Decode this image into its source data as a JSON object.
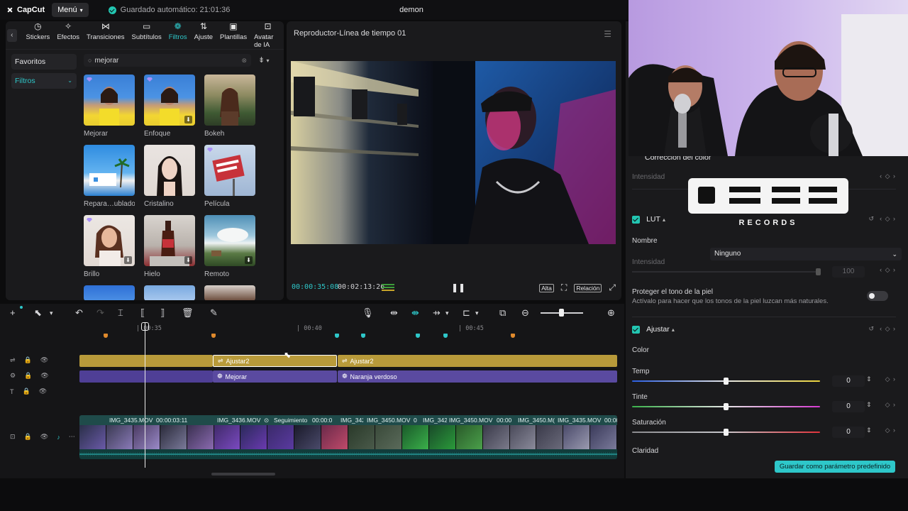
{
  "app": {
    "brand": "CapCut",
    "menu_label": "Menú",
    "autosave_text": "Guardado automático: 21:01:36",
    "project_name": "demon"
  },
  "media_tabs": [
    {
      "label": "Stickers",
      "icon": "clock-icon"
    },
    {
      "label": "Efectos",
      "icon": "star-icon"
    },
    {
      "label": "Transiciones",
      "icon": "bowtie-icon"
    },
    {
      "label": "Subtítulos",
      "icon": "caption-icon"
    },
    {
      "label": "Filtros",
      "icon": "filters-icon",
      "active": true
    },
    {
      "label": "Ajuste",
      "icon": "sliders-icon"
    },
    {
      "label": "Plantillas",
      "icon": "template-icon"
    },
    {
      "label": "Avatar de IA",
      "icon": "ai-avatar-icon"
    }
  ],
  "sidebar": {
    "items": [
      {
        "label": "Favoritos"
      },
      {
        "label": "Filtros",
        "active": true
      }
    ]
  },
  "search": {
    "value": "mejorar"
  },
  "filter_cards": [
    {
      "label": "Mejorar",
      "premium": true,
      "download": false
    },
    {
      "label": "Enfoque",
      "premium": true,
      "download": true
    },
    {
      "label": "Bokeh",
      "premium": false,
      "download": false
    },
    {
      "label": "Repara…ublado",
      "premium": false,
      "download": false
    },
    {
      "label": "Cristalino",
      "premium": false,
      "download": false
    },
    {
      "label": "Película",
      "premium": true,
      "download": false
    },
    {
      "label": "Brillo",
      "premium": true,
      "download": true
    },
    {
      "label": "Hielo",
      "premium": false,
      "download": true
    },
    {
      "label": "Remoto",
      "premium": false,
      "download": true
    }
  ],
  "player": {
    "title": "Reproductor-Línea de tiempo 01",
    "current_time": "00:00:35:08",
    "total_time": "00:02:13:26",
    "quality_label": "Alta",
    "ratio_label": "Relación"
  },
  "timeline": {
    "ruler_labels": [
      "| 00:35",
      "| 00:40",
      "| 00:45"
    ],
    "adjust_clips": [
      "Ajustar2",
      "Ajustar2"
    ],
    "filter_clips": [
      "Mejorar",
      "Naranja verdoso"
    ],
    "video_clips": [
      {
        "name": "IMG_3435.MOV",
        "duration": "00:00:03:11"
      },
      {
        "name": "IMG_3436.MOV"
      },
      {
        "name": "Seguimiento",
        "duration": "00:00:0"
      },
      {
        "name": "IMG_342"
      },
      {
        "name": "IMG_3450.MOV",
        "extra": "0"
      },
      {
        "name": "IMG_342"
      },
      {
        "name": "IMG_3450.MOV",
        "extra": "00:00"
      },
      {
        "name": "IMG_3450.M("
      },
      {
        "name": "IMG_3435.MOV",
        "extra": "00:00"
      }
    ]
  },
  "inspector": {
    "color_correction_title": "Corrección del color",
    "intensity_label": "Intensidad",
    "lut": {
      "title": "LUT",
      "name_label": "Nombre",
      "name_value": "Ninguno",
      "intensity_label": "Intensidad",
      "intensity_value": "100"
    },
    "skin_tone": {
      "title": "Proteger el tono de la piel",
      "description": "Actívalo para hacer que los tonos de la piel luzcan más naturales."
    },
    "adjust": {
      "title": "Ajustar",
      "color_label": "Color",
      "temp_label": "Temp",
      "temp_value": "0",
      "tint_label": "Tinte",
      "tint_value": "0",
      "saturation_label": "Saturación",
      "saturation_value": "0",
      "clarity_label": "Claridad"
    },
    "save_preset_label": "Guardar como parámetro predefinido"
  },
  "overlay_logo": {
    "text": "OES3",
    "subtext": "RECORDS"
  },
  "colors": {
    "accent": "#2ec7c9",
    "adjust_track": "#b89a3a",
    "filter_track": "#5a4aa0",
    "video_track_head": "#1f4b4a"
  }
}
